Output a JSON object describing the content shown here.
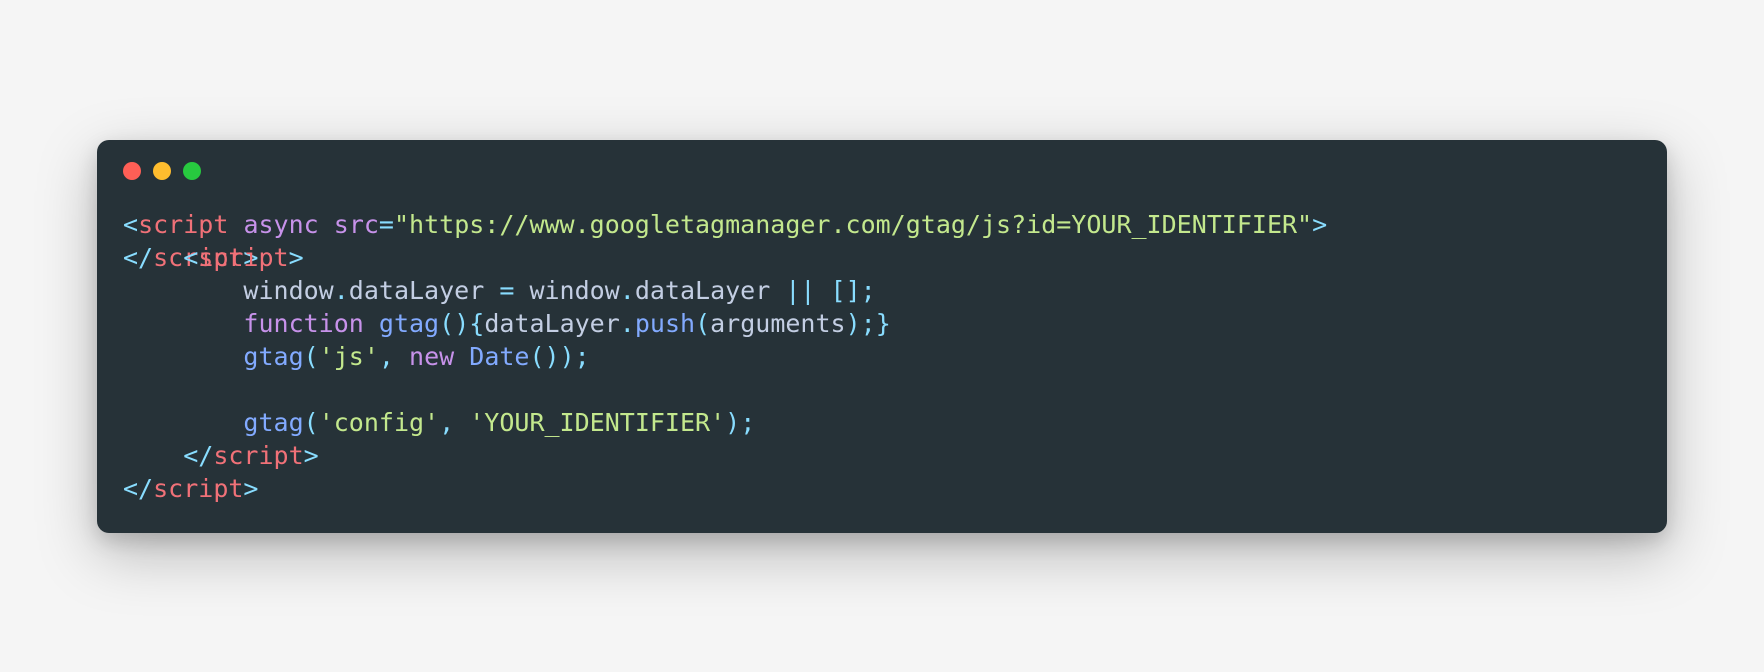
{
  "traffic_lights": [
    "red",
    "yellow",
    "green"
  ],
  "code": {
    "line1": {
      "open": "<",
      "tag": "script",
      "sp1": " ",
      "attr1": "async",
      "sp2": " ",
      "attr2": "src",
      "eq": "=",
      "url": "\"https://www.googletagmanager.com/gtag/js?id=YOUR_IDENTIFIER\"",
      "close": ">"
    },
    "line2": {
      "a_open": "</",
      "a_tag": "script",
      "a_close": ">",
      "b_indent": "    ",
      "b_open": "<",
      "b_tag": "script",
      "b_close": ">"
    },
    "line3": {
      "indent": "        ",
      "w1": "window",
      "dot1": ".",
      "dl1": "dataLayer",
      "sp1": " ",
      "eq": "=",
      "sp2": " ",
      "w2": "window",
      "dot2": ".",
      "dl2": "dataLayer",
      "sp3": " ",
      "or": "||",
      "sp4": " ",
      "lb": "[",
      "rb": "]",
      "semi": ";"
    },
    "line4": {
      "indent": "        ",
      "kw": "function",
      "sp1": " ",
      "fn": "gtag",
      "lp": "(",
      "rp": ")",
      "lb": "{",
      "dl": "dataLayer",
      "dot": ".",
      "push": "push",
      "lp2": "(",
      "args": "arguments",
      "rp2": ")",
      "semi": ";",
      "rb": "}"
    },
    "line5": {
      "indent": "        ",
      "fn": "gtag",
      "lp": "(",
      "s1": "'js'",
      "comma": ",",
      "sp": " ",
      "kw": "new",
      "sp2": " ",
      "cls": "Date",
      "lp2": "(",
      "rp2": ")",
      "rp": ")",
      "semi": ";"
    },
    "line6": "",
    "line7": {
      "indent": "        ",
      "fn": "gtag",
      "lp": "(",
      "s1": "'config'",
      "comma": ",",
      "sp": " ",
      "s2": "'YOUR_IDENTIFIER'",
      "rp": ")",
      "semi": ";"
    },
    "line8": {
      "indent": "    ",
      "open": "</",
      "tag": "script",
      "close": ">"
    },
    "line9": {
      "open": "</",
      "tag": "script",
      "close": ">"
    }
  }
}
